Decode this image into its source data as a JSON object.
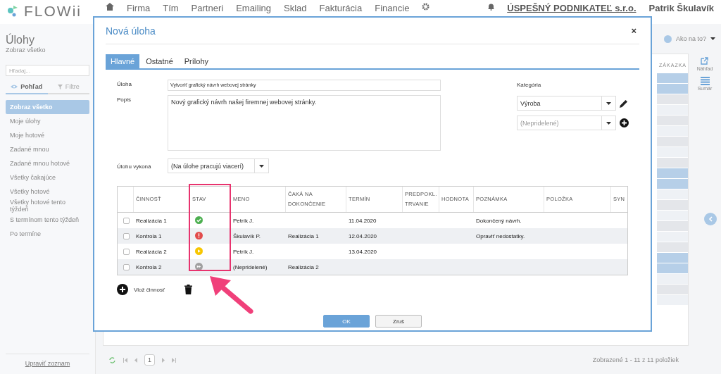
{
  "header": {
    "logo": "FLOWii",
    "nav": [
      "Firma",
      "Tím",
      "Partneri",
      "Emailing",
      "Sklad",
      "Fakturácia",
      "Financie"
    ],
    "company": "ÚSPEŠNÝ PODNIKATEĽ s.r.o.",
    "user": "Patrik Škulavík"
  },
  "sidebar": {
    "title": "Úlohy",
    "subtitle": "Zobraz všetko",
    "search_placeholder": "Hľadaj...",
    "tabs": [
      {
        "label": "Pohľad",
        "kind": "view",
        "selected": true
      },
      {
        "label": "Filtre",
        "kind": "filter",
        "selected": false
      }
    ],
    "items": [
      {
        "label": "Zobraz všetko",
        "selected": true
      },
      {
        "label": "Moje úlohy",
        "selected": false
      },
      {
        "label": "Moje hotové",
        "selected": false
      },
      {
        "label": "Zadané mnou",
        "selected": false
      },
      {
        "label": "Zadané mnou hotové",
        "selected": false
      },
      {
        "label": "Všetky čakajúce",
        "selected": false
      },
      {
        "label": "Všetky hotové",
        "selected": false
      },
      {
        "label": "Všetky hotové tento týždeň",
        "selected": false
      },
      {
        "label": "S termínom tento týždeň",
        "selected": false
      },
      {
        "label": "Po termíne",
        "selected": false
      }
    ],
    "footer_link": "Upraviť zoznam"
  },
  "toolbar": {
    "help": "Ako na to?"
  },
  "background_table": {
    "column": "ZÁKAZKA"
  },
  "right_rail": [
    {
      "label": "Náhľad",
      "kind": "preview"
    },
    {
      "label": "Sumár",
      "kind": "summary"
    }
  ],
  "pager": {
    "page": "1",
    "summary": "Zobrazené 1 - 11 z 11 položiek"
  },
  "modal": {
    "title": "Nová úloha",
    "close": "×",
    "tabs": [
      {
        "label": "Hlavné",
        "selected": true
      },
      {
        "label": "Ostatné",
        "selected": false
      },
      {
        "label": "Prílohy",
        "selected": false
      }
    ],
    "task_label": "Úloha",
    "task_value": "Vytvoriť grafický návrh webovej stránky",
    "description_label": "Popis",
    "description_value": "Nový grafický návrh našej firemnej webovej stránky.",
    "assignee_label": "Úlohu vykoná",
    "assignee_value": "(Na úlohe pracujú viacerí)",
    "category_label": "Kategória",
    "category_value": "Výroba",
    "subcategory_placeholder": "(Nepridelené)",
    "activities": {
      "columns": [
        "ČINNOSŤ",
        "STAV",
        "MENO",
        "ČAKÁ NA DOKONČENIE",
        "TERMÍN",
        "PREDPOKL. TRVANIE",
        "HODNOTA",
        "POZNÁMKA",
        "POLOŽKA",
        "SYN"
      ],
      "rows": [
        {
          "checked": false,
          "name": "Realizácia 1",
          "status": {
            "kind": "done"
          },
          "person": "Petrík J.",
          "waits_for": "",
          "deadline": "11.04.2020",
          "note": "Dokončený návrh."
        },
        {
          "checked": false,
          "name": "Kontrola 1",
          "status": {
            "kind": "error"
          },
          "person": "Škulavík P.",
          "waits_for": "Realizácia 1",
          "deadline": "12.04.2020",
          "note": "Opraviť nedostatky."
        },
        {
          "checked": false,
          "name": "Realizácia 2",
          "status": {
            "kind": "in_progress"
          },
          "person": "Petrík J.",
          "waits_for": "",
          "deadline": "13.04.2020",
          "note": ""
        },
        {
          "checked": false,
          "name": "Kontrola 2",
          "status": {
            "kind": "waiting"
          },
          "person": "(Nepridelené)",
          "waits_for": "Realizácia 2",
          "deadline": "",
          "note": ""
        }
      ]
    },
    "add_label": "Vlož činnosť",
    "buttons": [
      {
        "label": "OK",
        "kind": "primary"
      },
      {
        "label": "Zruš",
        "kind": "secondary"
      }
    ]
  }
}
